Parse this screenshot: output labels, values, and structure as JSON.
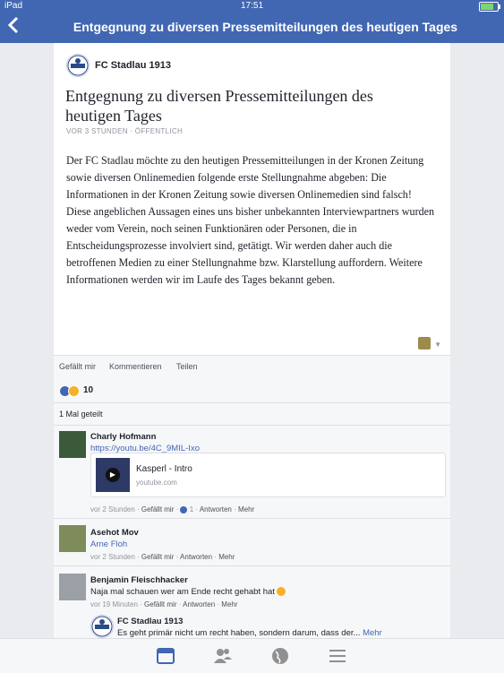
{
  "status": {
    "device": "iPad",
    "time": "17:51"
  },
  "nav": {
    "title": "Entgegnung zu diversen Pressemitteilungen des heutigen Tages"
  },
  "post": {
    "page_name": "FC Stadlau 1913",
    "title": "Entgegnung zu diversen Pressemitteilungen des heutigen Tages",
    "meta": "VOR 3 STUNDEN · ÖFFENTLICH",
    "body": "Der FC Stadlau möchte zu den heutigen Pressemitteilungen in der Kronen Zeitung sowie diversen Onlinemedien folgende erste Stellungnahme abgeben: Die Informationen in der Kronen Zeitung sowie diversen Onlinemedien sind falsch! Diese angeblichen Aussagen eines uns bisher unbekannten Interviewpartners wurden weder vom Verein, noch seinen Funktionären oder Personen, die in Entscheidungsprozesse involviert sind, getätigt. Wir werden daher auch die betroffenen Medien zu einer Stellungnahme bzw. Klarstellung auffordern. Weitere Informationen werden wir im Laufe des Tages bekannt geben."
  },
  "actions": {
    "like": "Gefällt mir",
    "comment": "Kommentieren",
    "share": "Teilen"
  },
  "reactions": {
    "count": "10"
  },
  "shares": "1 Mal geteilt",
  "comments": [
    {
      "name": "Charly Hofmann",
      "link": "https://youtu.be/4C_9MIL-Ixo",
      "card_title": "Kasperl - Intro",
      "card_domain": "youtube.com",
      "time": "vor 2 Stunden",
      "like": "Gefällt mir",
      "likes": "1",
      "reply": "Antworten",
      "more": "Mehr"
    },
    {
      "name": "Asehot Mov",
      "mention": "Arne Floh",
      "time": "vor 2 Stunden",
      "like": "Gefällt mir",
      "reply": "Antworten",
      "more": "Mehr"
    },
    {
      "name": "Benjamin Fleischhacker",
      "text": "Naja mal schauen wer am Ende recht gehabt hat",
      "time": "vor 19 Minuten",
      "like": "Gefällt mir",
      "reply": "Antworten",
      "more": "Mehr"
    }
  ],
  "reply": {
    "name": "FC Stadlau 1913",
    "text": "Es geht primär nicht um recht haben, sondern darum, dass der...",
    "more": "Mehr"
  }
}
